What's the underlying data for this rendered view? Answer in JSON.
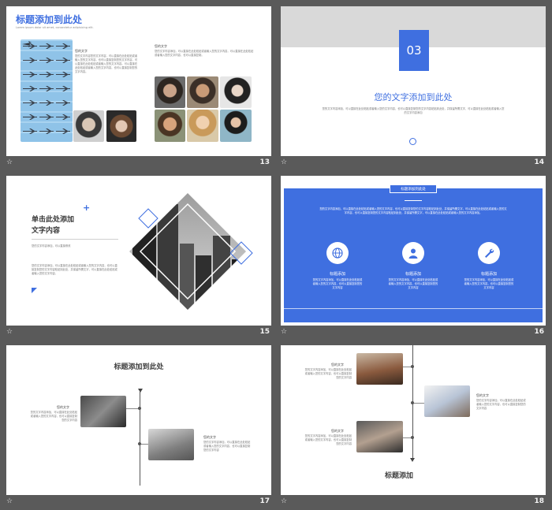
{
  "colors": {
    "accent": "#3f6fe0",
    "bg": "#5a5a5a"
  },
  "slides": [
    {
      "num": "13",
      "title": "标题添加到此处",
      "subtitle": "Lorem ipsum dolor sit amet, consectetur adipisicing elit.",
      "left_heading": "您的文字",
      "left_body": "您的文字内容您的文字内容，可以直接在此处粘贴或者输入您的文字内容，也可以直接复制您的文字内容，可以直接在此处粘贴或者输入您的文字内容。可以直接在此处粘贴或者输入您的文字内容，也可以直接复制您的文字内容。",
      "right_heading": "您的文字",
      "right_body": "您的文字内容添加，可以直接在此处粘贴或者输入您的文字内容，可以直接在此处粘贴或者输入您的文字内容，也可以直接复制。"
    },
    {
      "num": "14",
      "badge": "03",
      "title": "您的文字添加到此处",
      "body": "您的文字内容添加，可以直接在此处粘贴或者输入您的文字内容，也可以直接复制您的文字内容粘贴到此处，并保留所需文字，可以直接在此处粘贴或者输入您的文字内容添加"
    },
    {
      "num": "15",
      "title_line1": "单击此处添加",
      "title_line2": "文字内容",
      "line1": "您的文字内容添加，可以直接修改",
      "body": "您的文字内容添加，可以直接在此处粘贴或者输入您的文字内容，也可以直接复制您的文字内容粘贴到此处，并保留所需文字，可以直接在此处粘贴或者输入您的文字内容。"
    },
    {
      "num": "16",
      "title": "标题添加到此处",
      "body": "您的文字内容添加，可以直接在此处粘贴或者输入您的文字内容，也可以直接复制您的文字内容粘贴到此处，并保留所需文字，可以直接在此处粘贴或者输入您的文字内容，也可以直接复制您的文字内容粘贴到此处，并保留所需文字，可以直接在此处粘贴或者输入您的文字内容添加。",
      "items": [
        {
          "label": "标题添加",
          "icon": "globe-icon",
          "text": "您的文字内容添加，可以直接在此处粘贴或者输入您的文字内容，也可以直接复制您的文字内容"
        },
        {
          "label": "标题添加",
          "icon": "user-icon",
          "text": "您的文字内容添加，可以直接在此处粘贴或者输入您的文字内容，也可以直接复制您的文字内容"
        },
        {
          "label": "标题添加",
          "icon": "wrench-icon",
          "text": "您的文字内容添加，可以直接在此处粘贴或者输入您的文字内容，也可以直接复制您的文字内容"
        }
      ]
    },
    {
      "num": "17",
      "title": "标题添加到此处",
      "item1_heading": "您的文字",
      "item1_body": "您的文字内容添加，可以直接在此处粘贴或者输入您的文字内容，也可以直接复制您的文字内容",
      "item2_heading": "您的文字",
      "item2_body": "您的文字内容添加，可以直接在此处粘贴或者输入您的文字内容，也可以直接复制您的文字内容"
    },
    {
      "num": "18",
      "title": "标题添加",
      "item1_heading": "您的文字",
      "item1_body": "您的文字内容添加，可以直接在此处粘贴或者输入您的文字内容，也可以直接复制您的文字内容",
      "item2_heading": "您的文字",
      "item2_body": "您的文字内容添加，可以直接在此处粘贴或者输入您的文字内容，也可以直接复制您的文字内容",
      "item3_heading": "您的文字",
      "item3_body": "您的文字内容添加，可以直接在此处粘贴或者输入您的文字内容，也可以直接复制您的文字内容"
    }
  ]
}
